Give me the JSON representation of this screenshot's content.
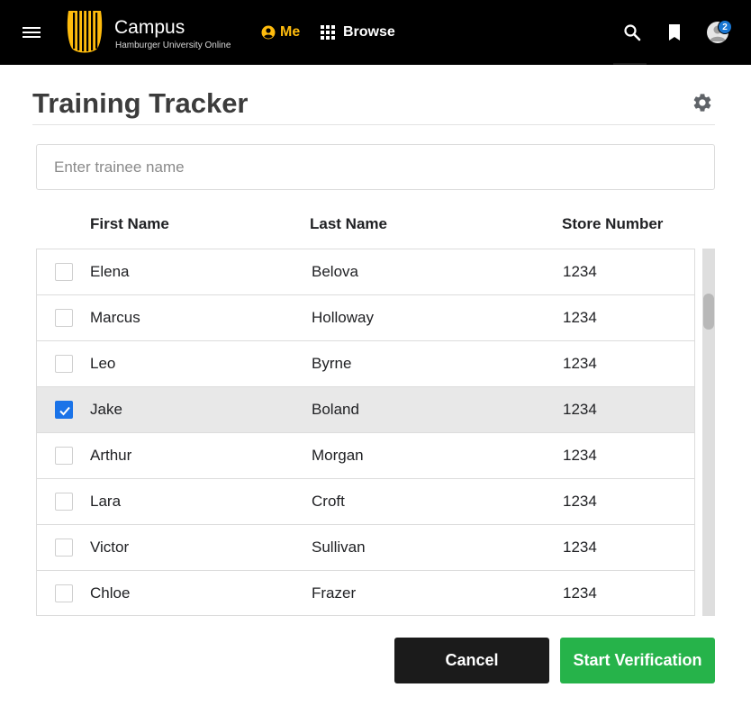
{
  "nav": {
    "brand_title": "Campus",
    "brand_subtitle": "Hamburger University Online",
    "me_label": "Me",
    "browse_label": "Browse",
    "notification_count": "2",
    "colors": {
      "bar": "#000000",
      "accent": "#ffbc0d",
      "badge": "#1976d2"
    },
    "icons": [
      "menu-icon",
      "campus-logo-icon",
      "account-circle-icon",
      "grid-icon",
      "search-icon",
      "bookmark-icon",
      "avatar-icon"
    ]
  },
  "page": {
    "title": "Training Tracker",
    "settings_icon": "gear-icon"
  },
  "search": {
    "placeholder": "Enter trainee name",
    "value": ""
  },
  "table": {
    "columns": [
      "First Name",
      "Last Name",
      "Store Number"
    ],
    "rows": [
      {
        "first": "Elena",
        "last": "Belova",
        "store": "1234",
        "checked": false
      },
      {
        "first": "Marcus",
        "last": "Holloway",
        "store": "1234",
        "checked": false
      },
      {
        "first": "Leo",
        "last": "Byrne",
        "store": "1234",
        "checked": false
      },
      {
        "first": "Jake",
        "last": "Boland",
        "store": "1234",
        "checked": true
      },
      {
        "first": "Arthur",
        "last": "Morgan",
        "store": "1234",
        "checked": false
      },
      {
        "first": "Lara",
        "last": "Croft",
        "store": "1234",
        "checked": false
      },
      {
        "first": "Victor",
        "last": "Sullivan",
        "store": "1234",
        "checked": false
      },
      {
        "first": "Chloe",
        "last": "Frazer",
        "store": "1234",
        "checked": false
      }
    ]
  },
  "actions": {
    "cancel_label": "Cancel",
    "start_label": "Start Verification",
    "colors": {
      "cancel": "#1b1b1b",
      "start": "#26b34a",
      "checkbox": "#1a73e8"
    }
  }
}
